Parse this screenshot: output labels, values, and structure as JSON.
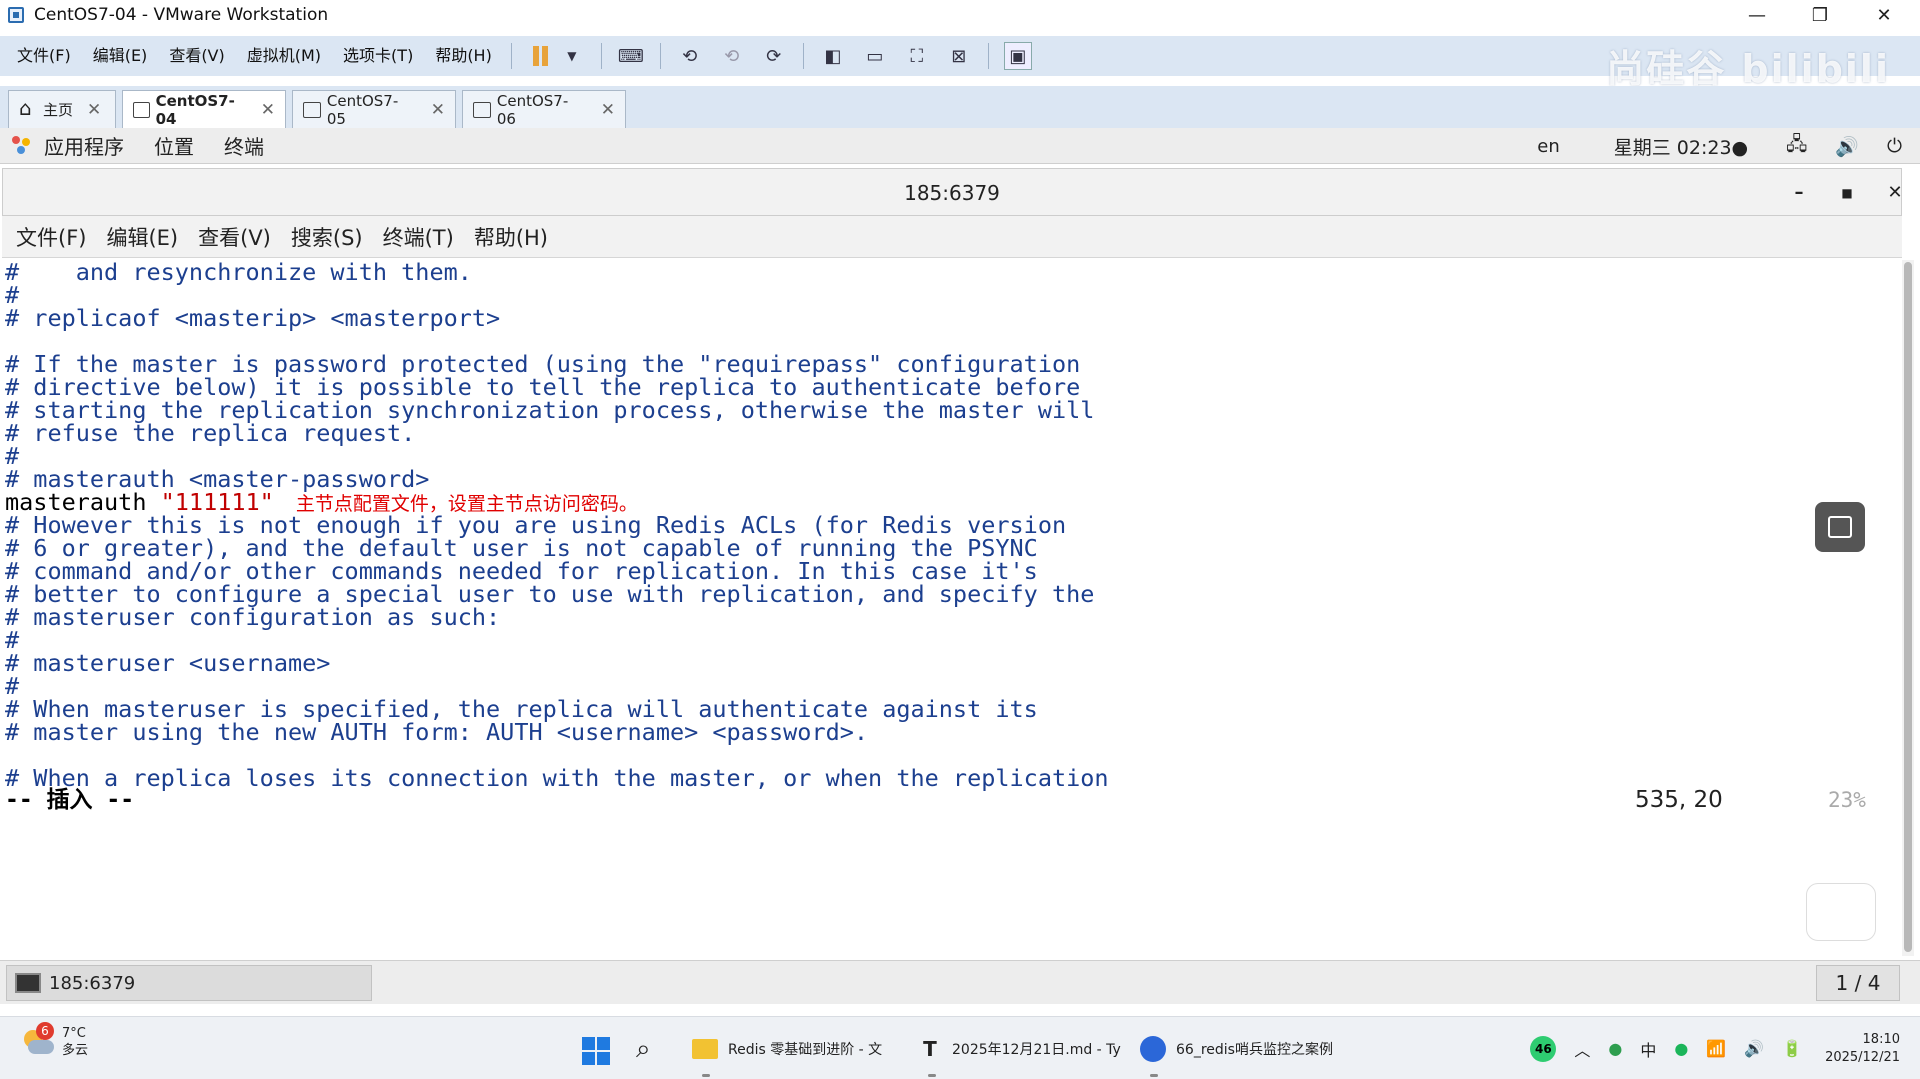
{
  "window": {
    "title": "CentOS7-04 - VMware Workstation"
  },
  "vm_menu": [
    "文件(F)",
    "编辑(E)",
    "查看(V)",
    "虚拟机(M)",
    "选项卡(T)",
    "帮助(H)"
  ],
  "watermark": "尚硅谷 bilibili",
  "vm_tabs": [
    {
      "label": "主页"
    },
    {
      "label": "CentOS7-04"
    },
    {
      "label": "CentOS7-05"
    },
    {
      "label": "CentOS7-06"
    }
  ],
  "gnome": {
    "menus": [
      "应用程序",
      "位置",
      "终端"
    ],
    "lang": "en",
    "clock": "星期三 02:23●"
  },
  "terminal": {
    "title": "185:6379",
    "menu": [
      "文件(F)",
      "编辑(E)",
      "查看(V)",
      "搜索(S)",
      "终端(T)",
      "帮助(H)"
    ],
    "lines": [
      "#    and resynchronize with them.",
      "#",
      "# replicaof <masterip> <masterport>",
      "",
      "# If the master is password protected (using the \"requirepass\" configuration",
      "# directive below) it is possible to tell the replica to authenticate before",
      "# starting the replication synchronization process, otherwise the master will",
      "# refuse the replica request.",
      "#",
      "# masterauth <master-password>",
      "",
      "# However this is not enough if you are using Redis ACLs (for Redis version",
      "# 6 or greater), and the default user is not capable of running the PSYNC",
      "# command and/or other commands needed for replication. In this case it's",
      "# better to configure a special user to use with replication, and specify the",
      "# masteruser configuration as such:",
      "#",
      "# masteruser <username>",
      "#",
      "# When masteruser is specified, the replica will authenticate against its",
      "# master using the new AUTH form: AUTH <username> <password>.",
      "",
      "# When a replica loses its connection with the master, or when the replication"
    ],
    "masterauth_keyword": "masterauth ",
    "masterauth_value": "\"111111\"",
    "annotation": "主节点配置文件，设置主节点访问密码。",
    "mode": "-- 插入 --",
    "position": "535, 20",
    "percent": "23%"
  },
  "bottom_bar": {
    "window_label": "185:6379",
    "workspace": "1 / 4"
  },
  "taskbar": {
    "weather_temp": "7°C",
    "weather_desc": "多云",
    "weather_badge": "6",
    "apps": [
      {
        "label": "Redis 零基础到进阶 - 文"
      },
      {
        "label": "2025年12月21日.md - Ty"
      },
      {
        "label": "66_redis哨兵监控之案例"
      }
    ],
    "tray_badge": "46",
    "ime": "中",
    "time": "18:10",
    "date": "2025/12/21"
  }
}
